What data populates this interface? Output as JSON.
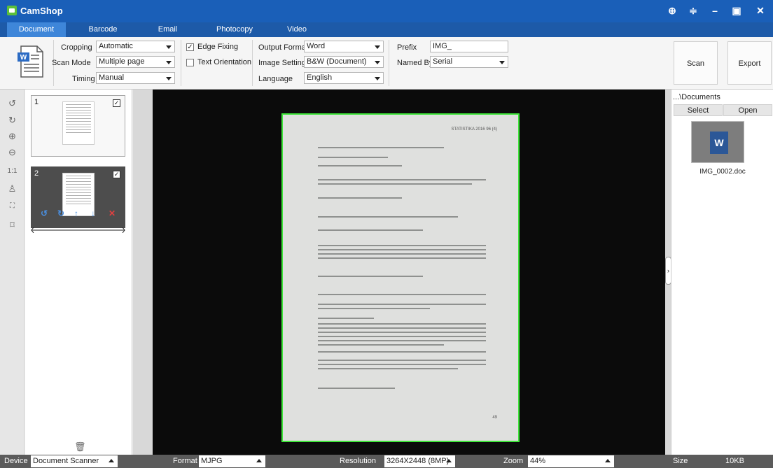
{
  "app": {
    "title": "CamShop"
  },
  "window_controls": [
    "globe-icon",
    "dropdown-icon",
    "minimize-icon",
    "restore-icon",
    "close-icon"
  ],
  "tabs": [
    "Document",
    "Barcode",
    "Email",
    "Photocopy",
    "Video"
  ],
  "active_tab": "Document",
  "toolbar": {
    "cropping": {
      "label": "Cropping",
      "value": "Automatic"
    },
    "scan_mode": {
      "label": "Scan Mode",
      "value": "Multiple page"
    },
    "timing": {
      "label": "Timing",
      "value": "Manual"
    },
    "edge_fixing": {
      "label": "Edge Fixing",
      "checked": true
    },
    "text_orientation": {
      "label": "Text Orientation",
      "checked": false
    },
    "output_format": {
      "label": "Output Format",
      "value": "Word"
    },
    "image_settings": {
      "label": "Image Settings",
      "value": "B&W (Document)"
    },
    "language": {
      "label": "Language",
      "value": "English"
    },
    "prefix": {
      "label": "Prefix",
      "value": "IMG_"
    },
    "named_by": {
      "label": "Named By",
      "value": "Serial"
    },
    "scan_label": "Scan",
    "export_label": "Export"
  },
  "tools": [
    "rotate-left-icon",
    "rotate-right-icon",
    "zoom-in-icon",
    "zoom-out-icon",
    "actual-size-icon",
    "stamp-icon",
    "fit-icon",
    "crop-icon"
  ],
  "thumbnails": [
    {
      "number": "1",
      "checked": true
    },
    {
      "number": "2",
      "checked": true
    }
  ],
  "document_preview": {
    "header": "STATISTIKA 2016 96 (4)",
    "page_number": "49"
  },
  "right_panel": {
    "path": "...\\Documents",
    "select_label": "Select",
    "open_label": "Open",
    "file_name": "IMG_0002.doc"
  },
  "statusbar": {
    "device_label": "Device",
    "device_value": "Document Scanner",
    "format_label": "Format",
    "format_value": "MJPG",
    "resolution_label": "Resolution",
    "resolution_value": "3264X2448 (8MP)",
    "zoom_label": "Zoom",
    "zoom_value": "44%",
    "size_label": "Size",
    "size_value": "10KB"
  }
}
